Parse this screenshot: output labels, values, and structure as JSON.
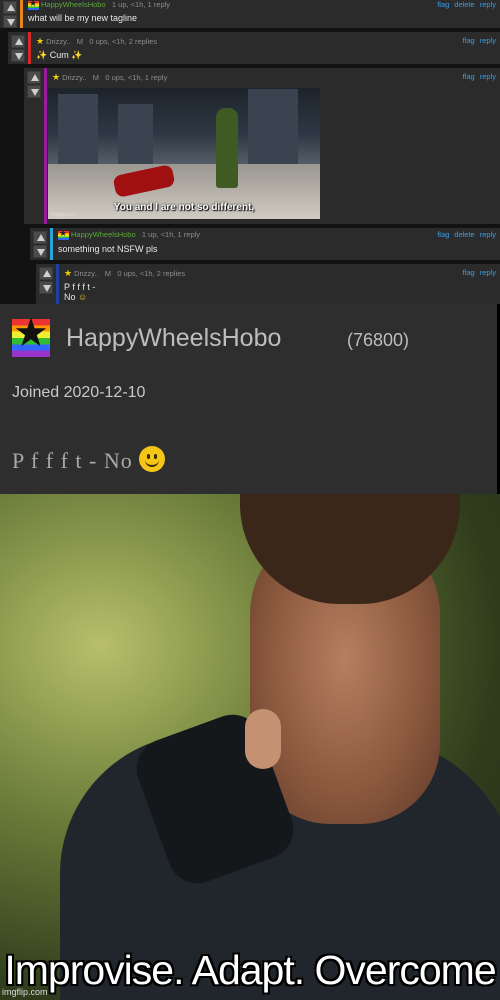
{
  "comments": [
    {
      "user": "HappyWheelsHobo",
      "meta": "1 up, <1h, 1 reply",
      "actions": [
        "flag",
        "delete",
        "reply"
      ],
      "text": "what will be my new tagline",
      "bar_color": "#e8841a"
    },
    {
      "user": "Drizzy..",
      "mod": "M",
      "meta": "0 ups, <1h, 2 replies",
      "actions": [
        "flag",
        "reply"
      ],
      "text": "Cum",
      "bar_color": "#d62828"
    },
    {
      "user": "Drizzy..",
      "mod": "M",
      "meta": "0 ups, <1h, 1 reply",
      "actions": [
        "flag",
        "reply"
      ],
      "bar_color": "#9b1aa0",
      "image_caption": "You and I are not so different,",
      "image_watermark": "imgflip.com"
    },
    {
      "user": "HappyWheelsHobo",
      "meta": "1 up, <1h, 1 reply",
      "actions": [
        "flag",
        "delete",
        "reply"
      ],
      "text": "something not NSFW pls",
      "bar_color": "#2aa3d8"
    },
    {
      "user": "Drizzy..",
      "mod": "M",
      "meta": "0 ups, <1h, 2 replies",
      "actions": [
        "flag",
        "reply"
      ],
      "text_line1": "P f f f t -",
      "text_line2": "No",
      "bar_color": "#1c3fa8"
    }
  ],
  "profile": {
    "username": "HappyWheelsHobo",
    "score": "(76800)",
    "joined": "Joined 2020-12-10",
    "tagline": "P f f f t - No"
  },
  "meme": {
    "caption": "Improvise. Adapt. Overcome",
    "watermark": "imgflip.com"
  }
}
